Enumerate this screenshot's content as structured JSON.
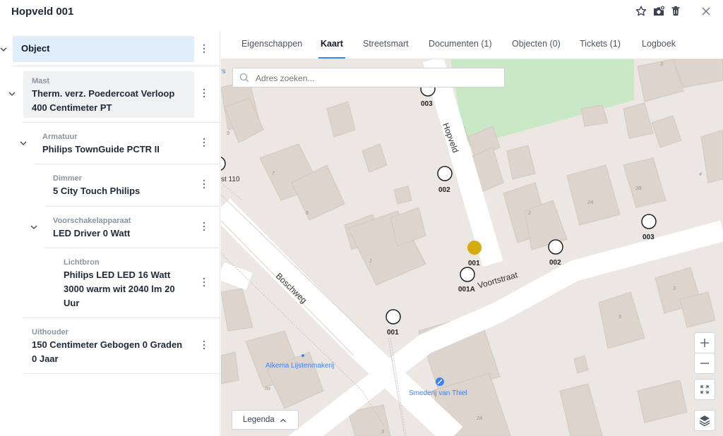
{
  "window": {
    "title": "Hopveld 001"
  },
  "header_icons": [
    "star-icon",
    "photo-add-icon",
    "trash-icon",
    "close-icon"
  ],
  "tree": {
    "object": {
      "label": "Object"
    },
    "mast": {
      "type": "Mast",
      "name_line1": "Therm. verz. Poedercoat Verloop",
      "name_line2": "400 Centimeter PT"
    },
    "armatuur": {
      "type": "Armatuur",
      "name": "Philips TownGuide PCTR II"
    },
    "dimmer": {
      "type": "Dimmer",
      "name": "5 City Touch Philips"
    },
    "voorschakel": {
      "type": "Voorschakelapparaat",
      "name": "LED Driver 0 Watt"
    },
    "lichtbron": {
      "type": "Lichtbron",
      "name_line1": "Philips LED LED 16 Watt",
      "name_line2": "3000 warm wit 2040 lm 20",
      "name_line3": "Uur"
    },
    "uithouder": {
      "type": "Uithouder",
      "name_line1": "150 Centimeter Gebogen 0 Graden",
      "name_line2": "0 Jaar"
    }
  },
  "tabs": [
    "Eigenschappen",
    "Kaart",
    "Streetsmart",
    "Documenten (1)",
    "Objecten (0)",
    "Tickets (1)",
    "Logboek"
  ],
  "active_tab": "Kaart",
  "map": {
    "search_placeholder": "Adres zoeken...",
    "legend_label": "Legenda",
    "streets": {
      "hopveld": "Hopveld",
      "voortstraat": "Voortstraat",
      "boschweg": "Boschweg"
    },
    "pois": {
      "lijstenmakerij": "Alkema Lijstenmakerij",
      "smederij": "Smederij van Thiel"
    },
    "edge_labels": {
      "top_left": "rs",
      "left": "st 110"
    },
    "house_numbers": [
      "3",
      "9",
      "7",
      "5",
      "1",
      "2",
      "2A",
      "2B",
      "4",
      "3",
      "5",
      "66",
      "3",
      "2A"
    ],
    "markers": [
      {
        "label": "003",
        "selected": false
      },
      {
        "label": "002",
        "selected": false
      },
      {
        "label": "001",
        "selected": true
      },
      {
        "label": "001A",
        "selected": false
      },
      {
        "label": "002",
        "selected": false
      },
      {
        "label": "003",
        "selected": false
      },
      {
        "label": "001",
        "selected": false
      }
    ],
    "selected_color": "#d4ac0d",
    "park_color": "#c9e8c6"
  },
  "colors": {
    "accent": "#3b82f6",
    "selected_bg": "#e0edfb",
    "hover_bg": "#f0f1f3"
  }
}
